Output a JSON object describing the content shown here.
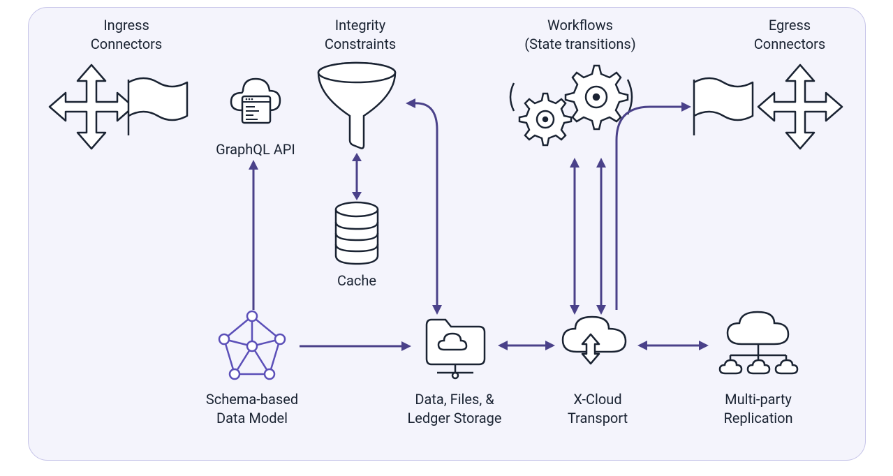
{
  "labels": {
    "ingress": "Ingress\nConnectors",
    "integrity": "Integrity\nConstraints",
    "workflows": "Workflows\n(State transitions)",
    "egress": "Egress\nConnectors",
    "graphql": "GraphQL API",
    "cache": "Cache",
    "schema": "Schema-based\nData Model",
    "storage": "Data, Files, &\nLedger Storage",
    "xcloud": "X-Cloud\nTransport",
    "replication": "Multi-party\nReplication"
  }
}
